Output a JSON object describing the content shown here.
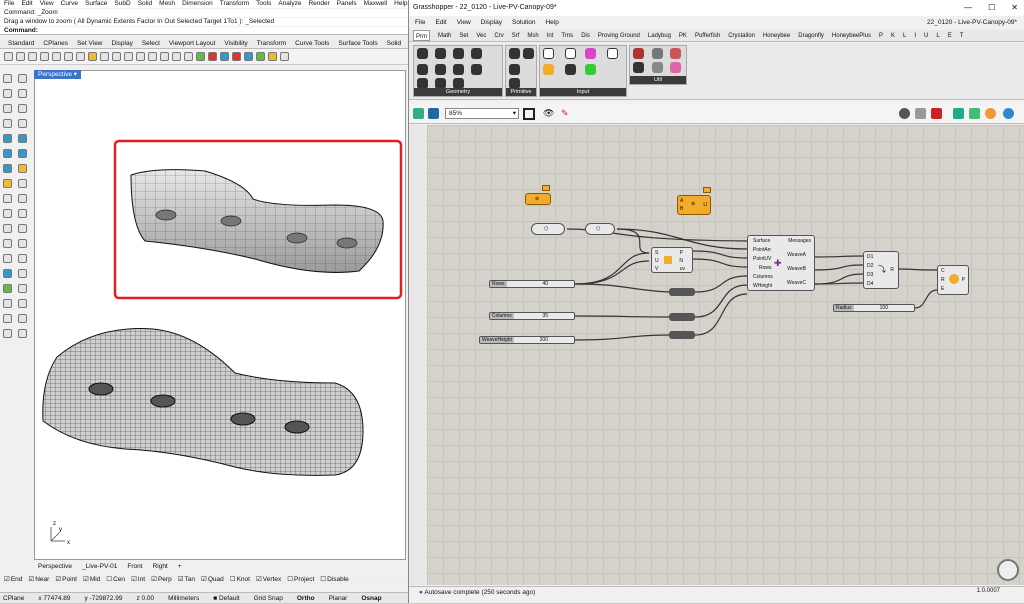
{
  "rhino": {
    "menu": [
      "File",
      "Edit",
      "View",
      "Curve",
      "Surface",
      "SubD",
      "Solid",
      "Mesh",
      "Dimension",
      "Transform",
      "Tools",
      "Analyze",
      "Render",
      "Panels",
      "Maxwell",
      "Help"
    ],
    "command_lines": [
      "Command: _Zoom",
      "Drag a window to zoom ( All  Dynamic  Extents  Factor  In  Out  Selected  Target  1To1 ): _Selected",
      "Command:"
    ],
    "toolbar_tabs": [
      "Standard",
      "CPlanes",
      "Set View",
      "Display",
      "Select",
      "Viewport Layout",
      "Visibility",
      "Transform",
      "Curve Tools",
      "Surface Tools",
      "Solid"
    ],
    "viewport_title": "Perspective",
    "view_tabs": [
      "Perspective",
      "_Live-PV-01",
      "Front",
      "Right"
    ],
    "add_tab": "+",
    "osnaps": [
      {
        "label": "End",
        "on": true
      },
      {
        "label": "Near",
        "on": true
      },
      {
        "label": "Point",
        "on": true
      },
      {
        "label": "Mid",
        "on": true
      },
      {
        "label": "Cen",
        "on": false
      },
      {
        "label": "Int",
        "on": true
      },
      {
        "label": "Perp",
        "on": true
      },
      {
        "label": "Tan",
        "on": true
      },
      {
        "label": "Quad",
        "on": true
      },
      {
        "label": "Knot",
        "on": false
      },
      {
        "label": "Vertex",
        "on": true
      },
      {
        "label": "Project",
        "on": false
      },
      {
        "label": "Disable",
        "on": false
      }
    ],
    "status": {
      "cplane": "CPlane",
      "x": "x 77474.89",
      "y": "y -729872.99",
      "z": "z 0.00",
      "units": "Millimeters",
      "layer": "Default",
      "grid_snap": "Grid Snap",
      "ortho": "Ortho",
      "planar": "Planar",
      "osnap": "Osnap"
    },
    "axes": {
      "x": "x",
      "y": "y",
      "z": "z"
    },
    "highlight_color": "#e02020"
  },
  "gh": {
    "title": "Grasshopper - 22_0120 - Live-PV-Canopy-09*",
    "window_buttons": [
      "—",
      "☐",
      "✕"
    ],
    "menu": [
      "File",
      "Edit",
      "View",
      "Display",
      "Solution",
      "Help"
    ],
    "doc_name": "22_0120 - Live-PV-Canopy-09*",
    "tabs": [
      "Prm",
      "Math",
      "Set",
      "Vec",
      "Crv",
      "Srf",
      "Msh",
      "Int",
      "Trns",
      "Dis",
      "Proving Ground",
      "Ladybug",
      "PK",
      "Pufferfish",
      "Crystallon",
      "Honeybee",
      "Dragonfly",
      "HoneybeePlus",
      "P",
      "K",
      "L",
      "I",
      "U",
      "L",
      "E",
      "T"
    ],
    "ribbon_groups": [
      "Geometry",
      "Primitive",
      "Input",
      "Util"
    ],
    "zoom": "85%",
    "nodes": {
      "main_inputs": [
        "Surface",
        "PointArr",
        "PointUV",
        "Rows",
        "Columns",
        "WHeight"
      ],
      "main_outputs": [
        "Messages",
        "WeaveA",
        "WeaveB",
        "WeaveC"
      ],
      "eval_inputs": [
        "S",
        "U",
        "V"
      ],
      "eval_outputs": [
        "P",
        "N",
        "uv"
      ],
      "merge_inputs": [
        "D1",
        "D2",
        "D3",
        "D4"
      ],
      "merge_output": "R",
      "pipe_inputs": [
        "C",
        "R",
        "E"
      ],
      "pipe_output": "P",
      "cluster_inputs": [
        "A",
        "B"
      ],
      "cluster_output": "U"
    },
    "sliders": [
      {
        "name": "Rows",
        "value": "40"
      },
      {
        "name": "Columns",
        "value": "35"
      },
      {
        "name": "WeaveHeight",
        "value": "200"
      },
      {
        "name": "Radius",
        "value": "100"
      }
    ],
    "status": "Autosave complete (250 seconds ago)",
    "version": "1.0.0007"
  }
}
